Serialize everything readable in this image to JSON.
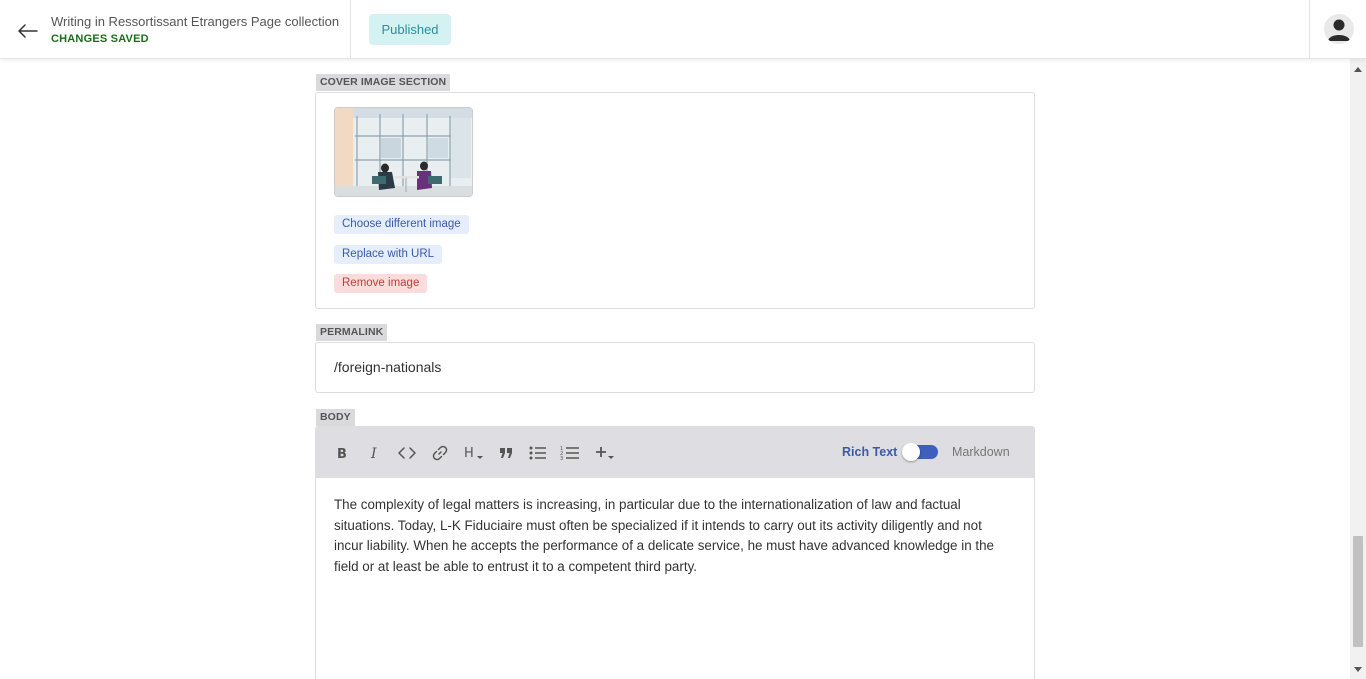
{
  "header": {
    "title": "Writing in Ressortissant Etrangers Page collection",
    "save_status": "CHANGES SAVED",
    "status_badge": "Published",
    "icons": {
      "back": "arrow-left-icon",
      "avatar": "user-avatar-icon"
    }
  },
  "cover_section": {
    "label": "COVER IMAGE SECTION",
    "image_alt": "cover-image-two-people-at-table",
    "choose_label": "Choose different image",
    "replace_label": "Replace with URL",
    "remove_label": "Remove image"
  },
  "permalink": {
    "label": "PERMALINK",
    "value": "/foreign-nationals"
  },
  "body": {
    "label": "BODY",
    "toolbar": {
      "icons": [
        "bold-icon",
        "italic-icon",
        "code-icon",
        "link-icon",
        "heading-icon",
        "quote-icon",
        "bullet-list-icon",
        "numbered-list-icon",
        "insert-icon"
      ],
      "rich_text_label": "Rich Text",
      "markdown_label": "Markdown",
      "toggle_on_rich_text": true
    },
    "content": "The complexity of legal matters is increasing, in particular due to the internationalization of law and factual situations. Today, L-K Fiduciaire must often be specialized if it intends to carry out its activity diligently and not incur liability. When he accepts the performance of a delicate service, he must have advanced knowledge in the field or at least be able to entrust it to a competent third party."
  },
  "colors": {
    "accent": "#3f5fbd",
    "saved_green": "#1a6e1a",
    "published_bg": "#d5f2f3",
    "published_text": "#2a8f96",
    "remove_red": "#c63b3b"
  }
}
